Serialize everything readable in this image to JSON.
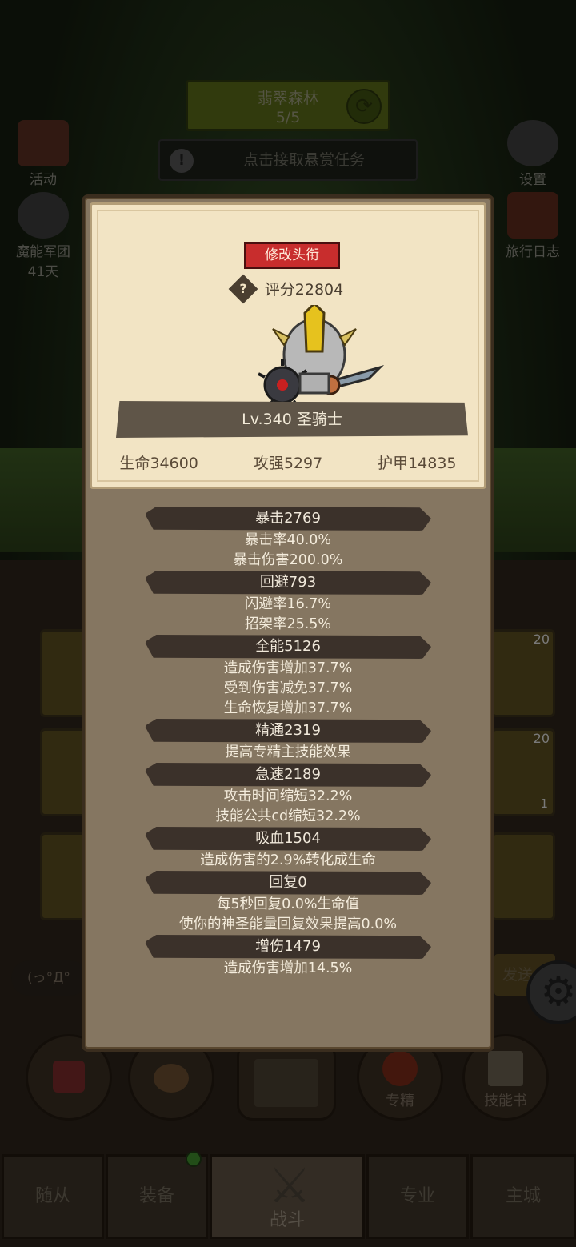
{
  "background": {
    "zone_title": "翡翠森林",
    "zone_progress": "5/5",
    "quest_text": "点击接取悬赏任务",
    "left_buttons": [
      {
        "label": "活动",
        "icon": "event-icon"
      },
      {
        "label": "魔能军团",
        "sub": "41天",
        "icon": "legion-icon"
      }
    ],
    "right_buttons": [
      {
        "label": "设置",
        "icon": "gear-icon"
      },
      {
        "label": "旅行日志",
        "icon": "journal-icon"
      }
    ],
    "chat_prefix": "(っ°Д°",
    "send_label": "发送",
    "slot_badges": [
      "20",
      "20",
      "1"
    ],
    "action_buttons": [
      {
        "label": "",
        "icon": "potion-icon"
      },
      {
        "label": "",
        "icon": "bread-icon"
      },
      {
        "label": "",
        "icon": "chest-icon"
      },
      {
        "label": "专精",
        "icon": "spec-icon"
      },
      {
        "label": "技能书",
        "icon": "skillbook-icon"
      }
    ],
    "tabs": [
      "随从",
      "装备",
      "战斗",
      "专业",
      "主城"
    ],
    "active_tab": "战斗"
  },
  "dialog": {
    "change_title_label": "修改头衔",
    "score_text": "评分22804",
    "level_text": "Lv.340 圣骑士",
    "stats": [
      "生命34600",
      "攻强5297",
      "护甲14835"
    ],
    "attributes": [
      {
        "head": "暴击2769",
        "lines": [
          "暴击率40.0%",
          "暴击伤害200.0%"
        ]
      },
      {
        "head": "回避793",
        "lines": [
          "闪避率16.7%",
          "招架率25.5%"
        ]
      },
      {
        "head": "全能5126",
        "lines": [
          "造成伤害增加37.7%",
          "受到伤害减免37.7%",
          "生命恢复增加37.7%"
        ]
      },
      {
        "head": "精通2319",
        "lines": [
          "提高专精主技能效果"
        ]
      },
      {
        "head": "急速2189",
        "lines": [
          "攻击时间缩短32.2%",
          "技能公共cd缩短32.2%"
        ]
      },
      {
        "head": "吸血1504",
        "lines": [
          "造成伤害的2.9%转化成生命"
        ]
      },
      {
        "head": "回复0",
        "lines": [
          "每5秒回复0.0%生命值",
          "使你的神圣能量回复效果提高0.0%"
        ]
      },
      {
        "head": "增伤1479",
        "lines": [
          "造成伤害增加14.5%"
        ]
      }
    ]
  },
  "colors": {
    "title_button": "#c82d2d",
    "card": "#f2e4c4",
    "panel": "#857661",
    "attr_header": "#3b312a"
  }
}
